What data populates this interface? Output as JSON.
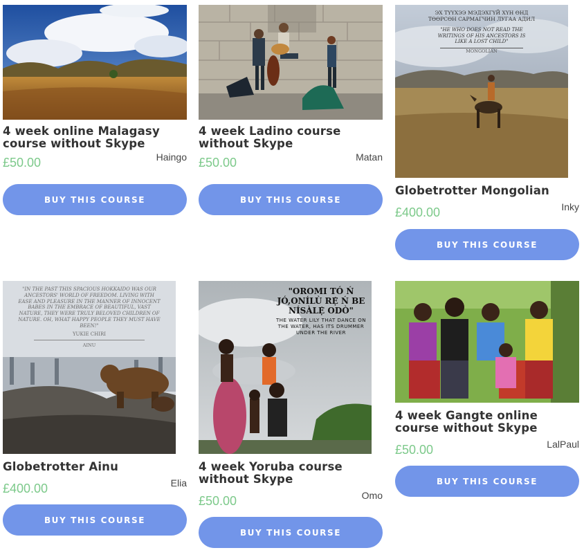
{
  "courses": [
    {
      "title": "4 week online Malagasy course without Skype",
      "price": "£50.00",
      "teacher": "Haingo",
      "button": "BUY THIS COURSE"
    },
    {
      "title": "4 week Ladino course without Skype",
      "price": "£50.00",
      "teacher": "Matan",
      "button": "BUY THIS COURSE"
    },
    {
      "title": "Globetrotter Mongolian",
      "price": "£400.00",
      "teacher": "Inky",
      "button": "BUY THIS COURSE",
      "image_text": {
        "line1": "ЭХ ТҮҮХЭЭ МЭДЭХГҮЙ ХҮН ӨНД",
        "line2": "ТӨӨРСӨН САРМАГЧИН ЛУГАА АДИЛ",
        "quote": "\"HE WHO DOES NOT READ THE WRITINGS OF HIS ANCESTORS IS LIKE A LOST CHILD\"",
        "attribution": "MONGOLIAN"
      }
    },
    {
      "title": "Globetrotter Ainu",
      "price": "£400.00",
      "teacher": "Elia",
      "button": "BUY THIS COURSE",
      "image_text": {
        "quote": "\"IN THE PAST THIS SPACIOUS HOKKAIDO WAS OUR ANCESTORS' WORLD OF FREEDOM. LIVING WITH EASE AND PLEASURE IN THE MANNER OF INNOCENT BABES IN THE EMBRACE OF BEAUTIFUL, VAST NATURE, THEY WERE TRULY BELOVED CHILDREN OF NATURE. OH, WHAT HAPPY PEOPLE THEY MUST HAVE BEEN!\"",
        "author": "YUKIE CHIRI",
        "attribution": "AINU"
      }
    },
    {
      "title": "4 week Yoruba course without Skype",
      "price": "£50.00",
      "teacher": "Omo",
      "button": "BUY THIS COURSE",
      "image_text": {
        "heading": "\"OROMI TÓ Ń JÓ,ONÍLÙ RẸ̀ Ń BE NÍSÀLẸ̀ ODÒ\"",
        "quote": "THE WATER LILY THAT DANCE ON THE WATER, HAS ITS DRUMMER UNDER THE RIVER"
      }
    },
    {
      "title": "4 week Gangte online course without Skype",
      "price": "£50.00",
      "teacher": "LalPaul",
      "button": "BUY THIS COURSE"
    }
  ]
}
